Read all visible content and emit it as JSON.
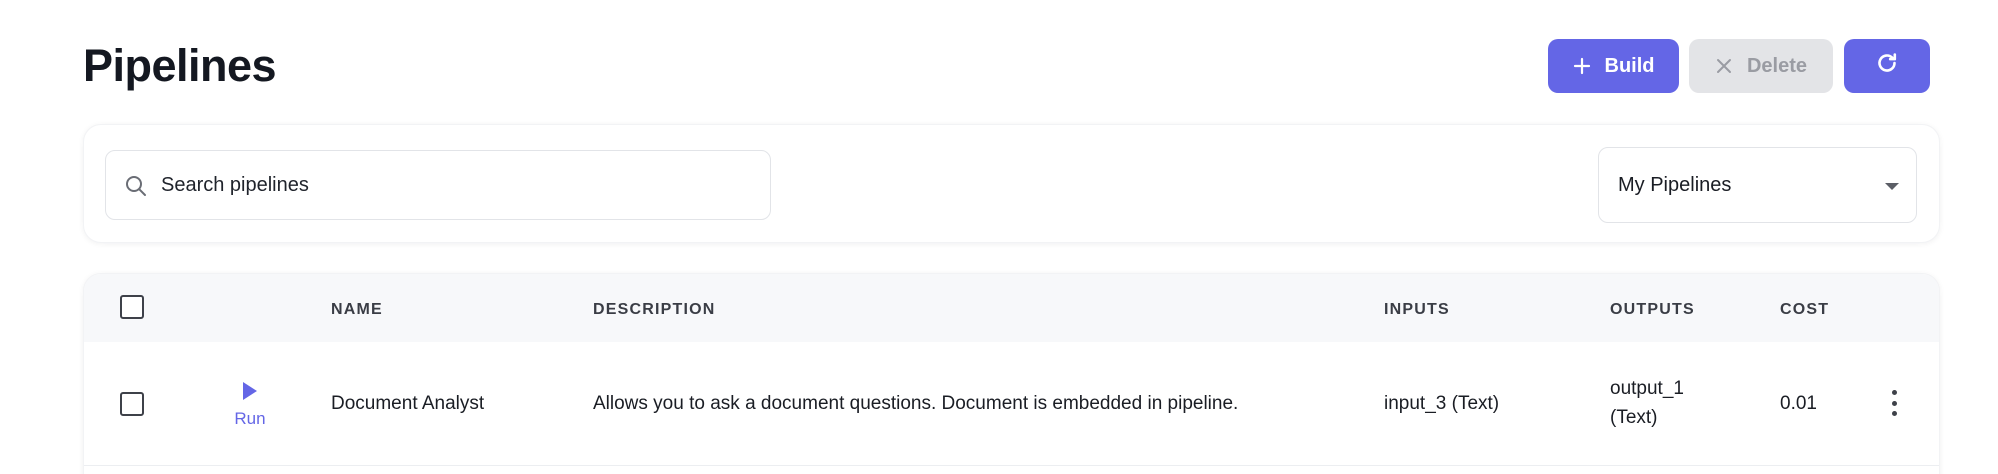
{
  "header": {
    "title": "Pipelines",
    "build_label": "Build",
    "delete_label": "Delete"
  },
  "filters": {
    "search_placeholder": "Search pipelines",
    "search_value": "",
    "scope_select_value": "My Pipelines"
  },
  "table": {
    "columns": {
      "name": "NAME",
      "description": "DESCRIPTION",
      "inputs": "INPUTS",
      "outputs": "OUTPUTS",
      "cost": "COST"
    },
    "run_label": "Run",
    "rows": [
      {
        "name": "Document Analyst",
        "description": "Allows you to ask a document questions. Document is embedded in pipeline.",
        "inputs": "input_3 (Text)",
        "outputs_line1": "output_1",
        "outputs_line2": "(Text)",
        "cost": "0.01"
      }
    ]
  },
  "colors": {
    "accent": "#6466e6",
    "disabled_bg": "#e3e4e7",
    "disabled_text": "#9a9ca3",
    "table_header_bg": "#f7f8fa"
  },
  "icons": [
    "plus-icon",
    "close-icon",
    "refresh-icon",
    "search-icon",
    "chevron-down-icon",
    "play-icon",
    "more-vertical-icon"
  ]
}
